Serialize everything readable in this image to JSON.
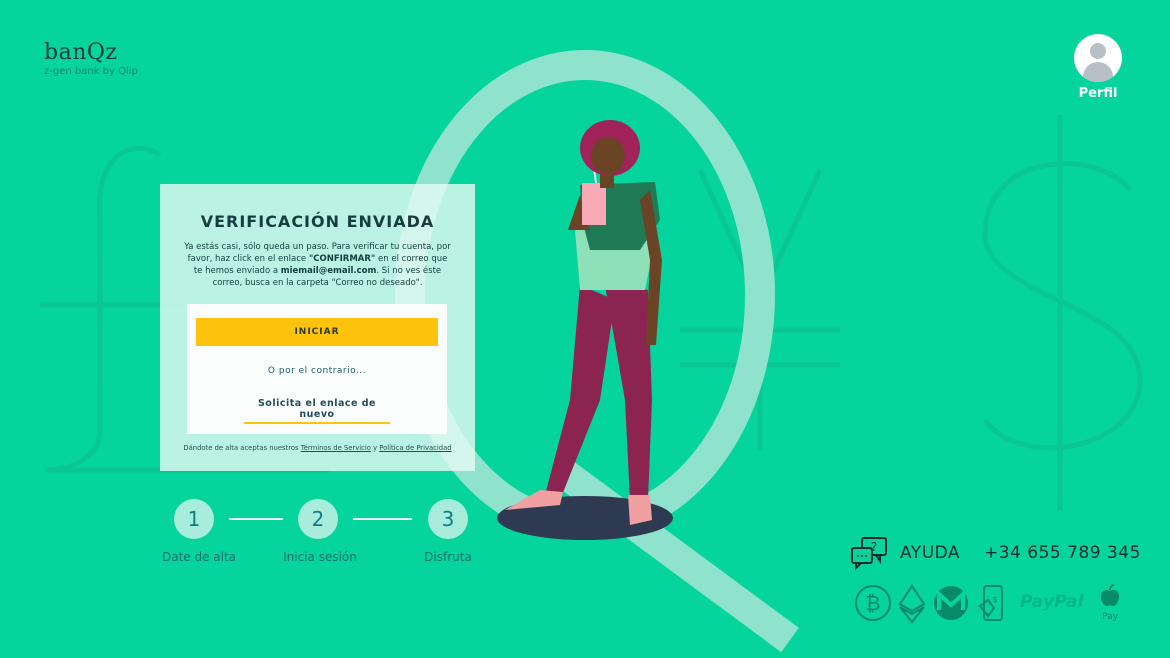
{
  "brand": {
    "name": "banQz",
    "tagline": "z-gen bank by Qlip"
  },
  "profile": {
    "label": "Perfil"
  },
  "card": {
    "title": "VERIFICACIÓN ENVIADA",
    "text_before_confirm": "Ya estás casi, sólo queda un paso. Para verificar tu cuenta, por favor, haz click en el enlace ",
    "confirm_link": "\"CONFIRMAR\"",
    "text_after_confirm": " en el correo que te hemos enviado a ",
    "email": "miemail@email.com",
    "text_end": ". Si no ves éste correo, busca en la carpeta \"Correo no deseado\".",
    "start_button": "INICIAR",
    "or_text": "O por el contrario...",
    "resend_link": "Solicita el enlace de nuevo",
    "terms_prefix": "Dándote de alta aceptas nuestros ",
    "terms_link": "Términos de Servicio",
    "terms_and": " y ",
    "privacy_link": "Política de Privacidad"
  },
  "steps": [
    {
      "number": "1",
      "label": "Date de alta"
    },
    {
      "number": "2",
      "label": "Inicia sesión"
    },
    {
      "number": "3",
      "label": "Disfruta"
    }
  ],
  "help": {
    "label": "AYUDA",
    "phone": "+34 655 789 345"
  },
  "payments": {
    "methods": [
      "bitcoin-icon",
      "ethereum-icon",
      "monero-icon",
      "mobile-payment-icon",
      "paypal-logo",
      "apple-pay-logo"
    ],
    "paypal_label": "PayPal",
    "apple_pay_label": "Pay"
  },
  "colors": {
    "background": "#05d49c",
    "accent_yellow": "#fec40d",
    "step_circle": "#a8ecdc",
    "card_bg": "#e3faf3",
    "illustration_pants": "#8b2450",
    "illustration_top": "#1f7a55"
  }
}
